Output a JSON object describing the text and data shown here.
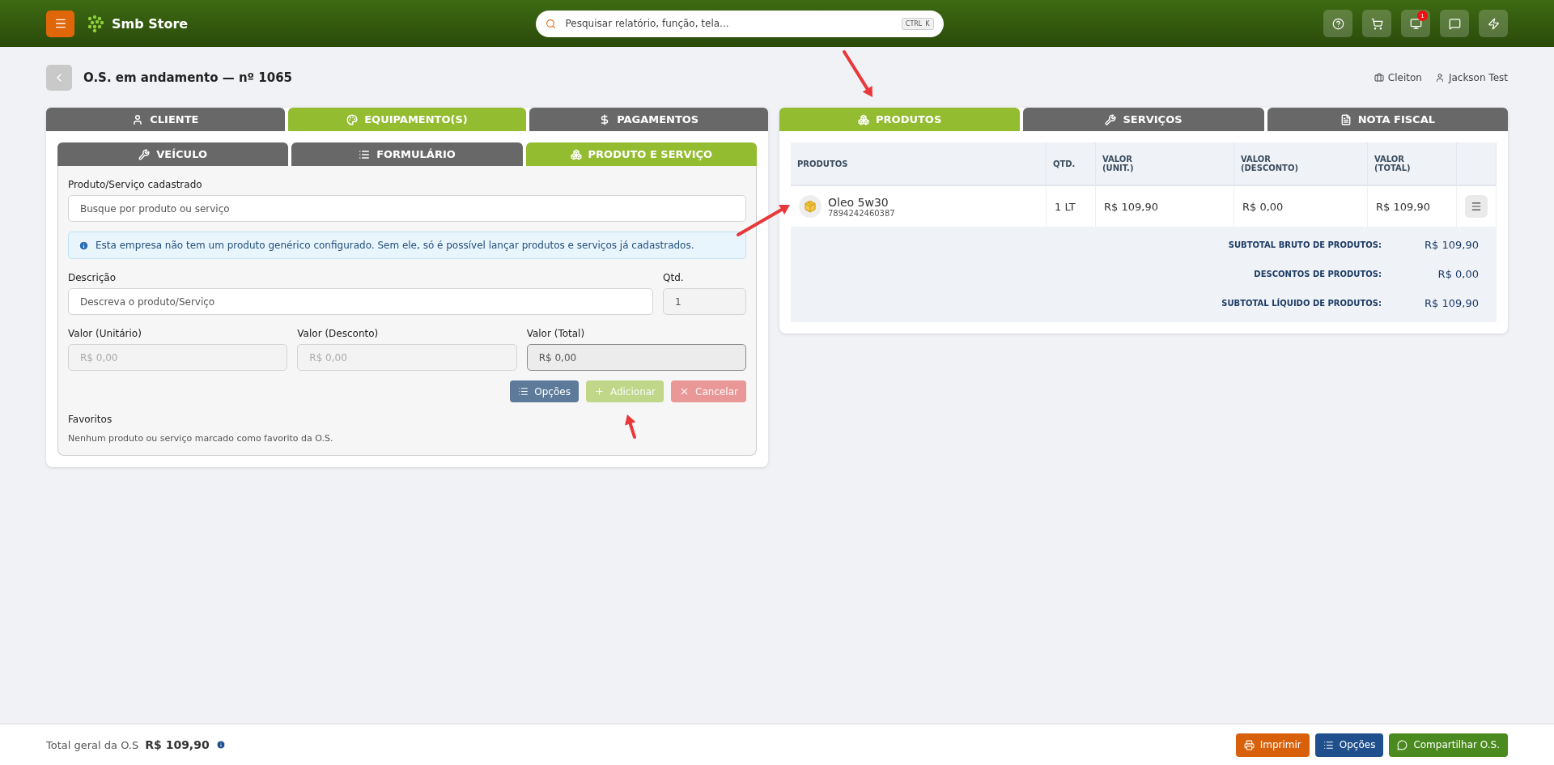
{
  "header": {
    "brand": "Smb Store",
    "search": {
      "placeholder": "Pesquisar relatório, função, tela...",
      "shortcut": [
        "CTRL",
        "K"
      ]
    },
    "actions": [
      {
        "kind": "help"
      },
      {
        "kind": "cart"
      },
      {
        "kind": "monitor",
        "badge": "1"
      },
      {
        "kind": "chat"
      },
      {
        "kind": "bolt"
      }
    ]
  },
  "page": {
    "title": "O.S. em andamento — nº 1065",
    "users": [
      {
        "kind": "company",
        "name": "Cleiton"
      },
      {
        "kind": "person",
        "name": "Jackson Test"
      }
    ]
  },
  "left_panel": {
    "tabs": [
      {
        "kind": "person",
        "label": "CLIENTE",
        "selected": false
      },
      {
        "kind": "palette",
        "label": "EQUIPAMENTO(S)",
        "selected": true
      },
      {
        "kind": "dollar",
        "label": "PAGAMENTOS",
        "selected": false
      }
    ],
    "subtabs": [
      {
        "kind": "tools",
        "label": "VEÍCULO",
        "selected": false
      },
      {
        "kind": "list",
        "label": "FORMULÁRIO",
        "selected": false
      },
      {
        "kind": "boxes",
        "label": "PRODUTO E SERVIÇO",
        "selected": true
      }
    ],
    "product_field": {
      "label": "Produto/Serviço cadastrado",
      "placeholder": "Busque por produto ou serviço"
    },
    "info": "Esta empresa não tem um produto genérico configurado. Sem ele, só é possível lançar produtos e serviços já cadastrados.",
    "description_field": {
      "label": "Descrição",
      "placeholder": "Descreva o produto/Serviço"
    },
    "qty_field": {
      "label": "Qtd.",
      "value": "1",
      "disabled": true
    },
    "value_fields": [
      {
        "label": "Valor (Unitário)",
        "placeholder": "R$ 0,00",
        "disabled": true
      },
      {
        "label": "Valor (Desconto)",
        "placeholder": "R$ 0,00",
        "disabled": true
      },
      {
        "label": "Valor (Total)",
        "placeholder": "R$ 0,00",
        "disabled": false
      }
    ],
    "buttons": [
      {
        "kind": "options",
        "label": "Opções",
        "disabled": false
      },
      {
        "kind": "add",
        "label": "Adicionar",
        "disabled": true
      },
      {
        "kind": "cancel",
        "label": "Cancelar",
        "disabled": true
      }
    ],
    "favorites": {
      "title": "Favoritos",
      "empty": "Nenhum produto ou serviço marcado como favorito da O.S."
    }
  },
  "right_panel": {
    "tabs": [
      {
        "kind": "boxes",
        "label": "PRODUTOS",
        "selected": true
      },
      {
        "kind": "tools",
        "label": "SERVIÇOS",
        "selected": false
      },
      {
        "kind": "file",
        "label": "NOTA FISCAL",
        "selected": false
      }
    ],
    "table": {
      "columns": [
        "PRODUTOS",
        "QTD.",
        "VALOR\n(UNIT.)",
        "VALOR\n(DESCONTO)",
        "VALOR\n(TOTAL)"
      ],
      "rows": [
        {
          "name": "Oleo 5w30",
          "code": "7894242460387",
          "qty": "1 LT",
          "unit": "R$ 109,90",
          "discount": "R$ 0,00",
          "total": "R$ 109,90"
        }
      ]
    },
    "totals": [
      {
        "label": "SUBTOTAL BRUTO DE PRODUTOS:",
        "value": "R$ 109,90"
      },
      {
        "label": "DESCONTOS DE PRODUTOS:",
        "value": "R$ 0,00"
      },
      {
        "label": "SUBTOTAL LÍQUIDO DE PRODUTOS:",
        "value": "R$ 109,90"
      }
    ]
  },
  "footer": {
    "label": "Total geral da O.S",
    "value": "R$ 109,90",
    "buttons": [
      {
        "kind": "print",
        "label": "Imprimir"
      },
      {
        "kind": "options",
        "label": "Opções"
      },
      {
        "kind": "share",
        "label": "Compartilhar O.S."
      }
    ]
  }
}
